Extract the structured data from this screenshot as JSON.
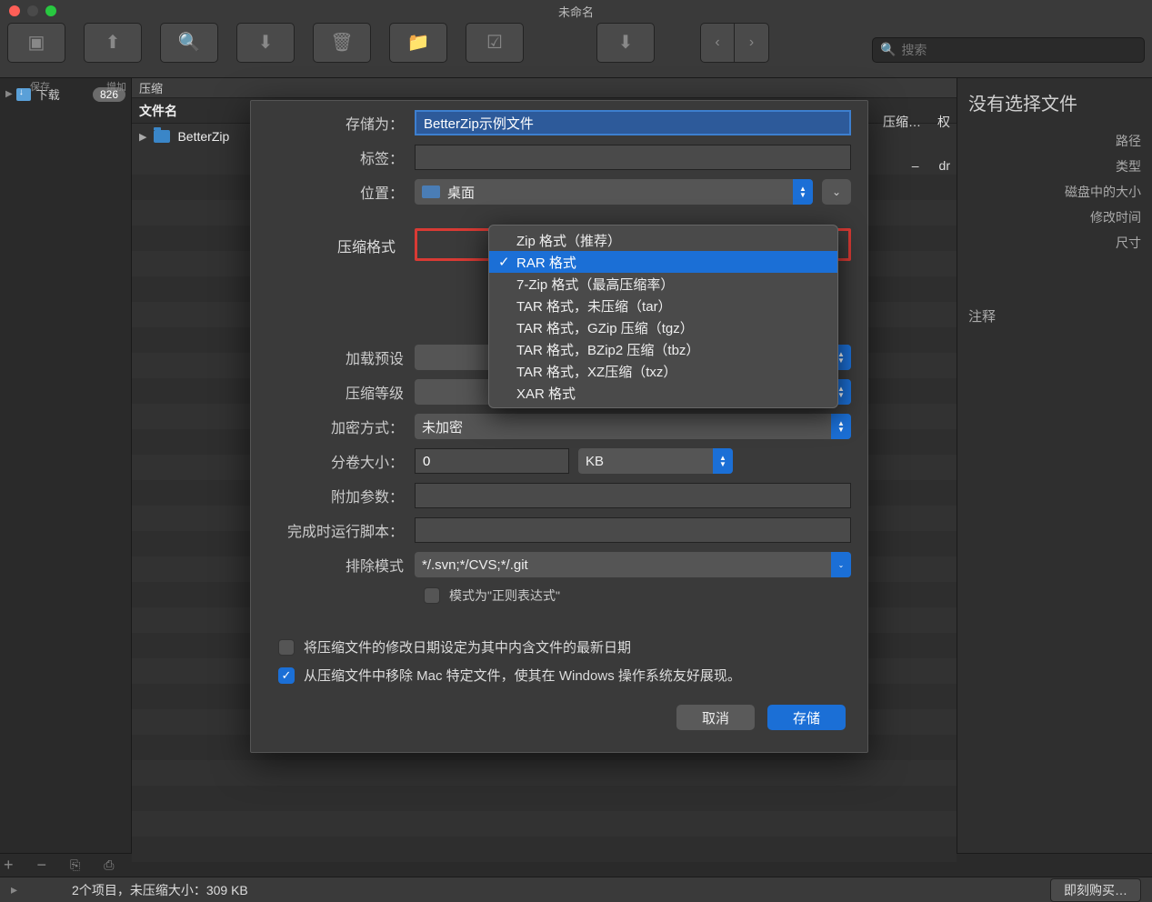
{
  "window": {
    "title": "未命名"
  },
  "toolbar": {
    "save": "保存",
    "add": "增加",
    "view": "查看",
    "extract": "解压",
    "delete": "删除",
    "newfolder": "新文件夹",
    "test": "测试",
    "runmode": "立即执行模式",
    "goto": "转到"
  },
  "search": {
    "placeholder": "搜索"
  },
  "sidebar": {
    "downloads": "下载",
    "badge": "826"
  },
  "crumb": "压缩",
  "columns": {
    "name": "文件名",
    "compress": "压缩…",
    "perm": "权"
  },
  "files": [
    {
      "name": "BetterZip",
      "perm": "dr",
      "size": "–"
    }
  ],
  "right": {
    "noselection": "没有选择文件",
    "path": "路径",
    "type": "类型",
    "disksize": "磁盘中的大小",
    "mtime": "修改时间",
    "dim": "尺寸",
    "notes": "注释"
  },
  "sheet": {
    "saveas_label": "存储为：",
    "saveas_value": "BetterZip示例文件",
    "tags_label": "标签：",
    "location_label": "位置：",
    "location_value": "桌面",
    "format_label": "压缩格式",
    "preset_label": "加载预设",
    "level_label": "压缩等级",
    "encrypt_label": "加密方式：",
    "encrypt_value": "未加密",
    "volume_label": "分卷大小：",
    "volume_value": "0",
    "volume_unit": "KB",
    "params_label": "附加参数：",
    "script_label": "完成时运行脚本：",
    "exclude_label": "排除模式",
    "exclude_value": "*/.svn;*/CVS;*/.git",
    "regex_label": "模式为\"正则表达式\"",
    "opt_mtime": "将压缩文件的修改日期设定为其中内含文件的最新日期",
    "opt_stripmac": "从压缩文件中移除 Mac 特定文件，使其在 Windows 操作系统友好展现。",
    "cancel": "取消",
    "save": "存储"
  },
  "format_options": [
    "Zip 格式（推荐）",
    "RAR 格式",
    "7-Zip 格式（最高压缩率）",
    "TAR 格式，未压缩（tar）",
    "TAR 格式，GZip 压缩（tgz）",
    "TAR 格式，BZip2 压缩（tbz）",
    "TAR 格式，XZ压缩（txz）",
    "XAR 格式"
  ],
  "status": {
    "items": "2个项目，未压缩大小：309 KB",
    "buynow": "即刻购买…"
  }
}
